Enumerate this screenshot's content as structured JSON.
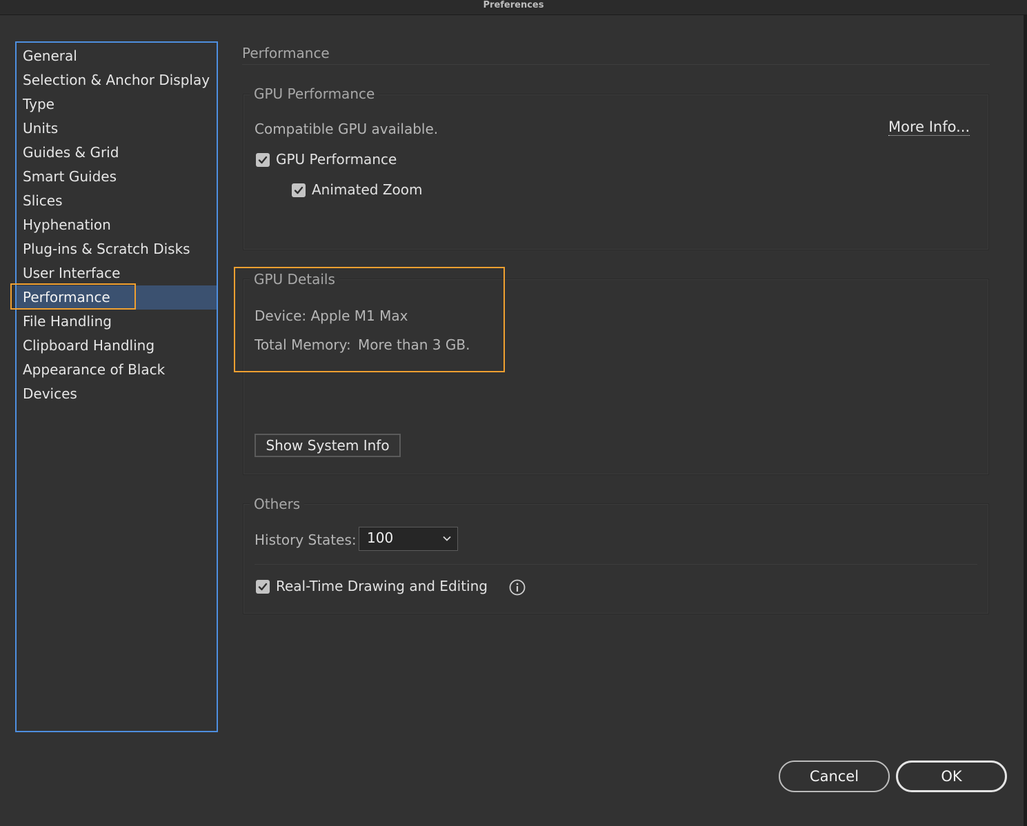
{
  "window": {
    "title": "Preferences"
  },
  "sidebar": {
    "items": [
      {
        "label": "General"
      },
      {
        "label": "Selection & Anchor Display"
      },
      {
        "label": "Type"
      },
      {
        "label": "Units"
      },
      {
        "label": "Guides & Grid"
      },
      {
        "label": "Smart Guides"
      },
      {
        "label": "Slices"
      },
      {
        "label": "Hyphenation"
      },
      {
        "label": "Plug-ins & Scratch Disks"
      },
      {
        "label": "User Interface"
      },
      {
        "label": "Performance",
        "selected": true
      },
      {
        "label": "File Handling"
      },
      {
        "label": "Clipboard Handling"
      },
      {
        "label": "Appearance of Black"
      },
      {
        "label": "Devices"
      }
    ]
  },
  "main": {
    "page_title": "Performance",
    "gpu_performance": {
      "title": "GPU Performance",
      "status_text": "Compatible GPU available.",
      "more_info_label": "More Info...",
      "gpu_checkbox": {
        "label": "GPU Performance",
        "checked": true
      },
      "animated_zoom_checkbox": {
        "label": "Animated Zoom",
        "checked": true
      }
    },
    "gpu_details": {
      "title": "GPU Details",
      "device_text": "Device: Apple M1 Max",
      "memory_label": "Total Memory:",
      "memory_value": "More than 3 GB.",
      "show_system_info_label": "Show System Info"
    },
    "others": {
      "title": "Others",
      "history_label": "History States:",
      "history_value": "100",
      "realtime_checkbox": {
        "label": "Real-Time Drawing and Editing",
        "checked": true
      },
      "info_icon": "info-icon"
    }
  },
  "footer": {
    "cancel_label": "Cancel",
    "ok_label": "OK"
  },
  "colors": {
    "background": "#323232",
    "sidebar_border": "#4e8fe0",
    "selected_item": "#3b5170",
    "annotation_highlight": "#f0a030"
  }
}
